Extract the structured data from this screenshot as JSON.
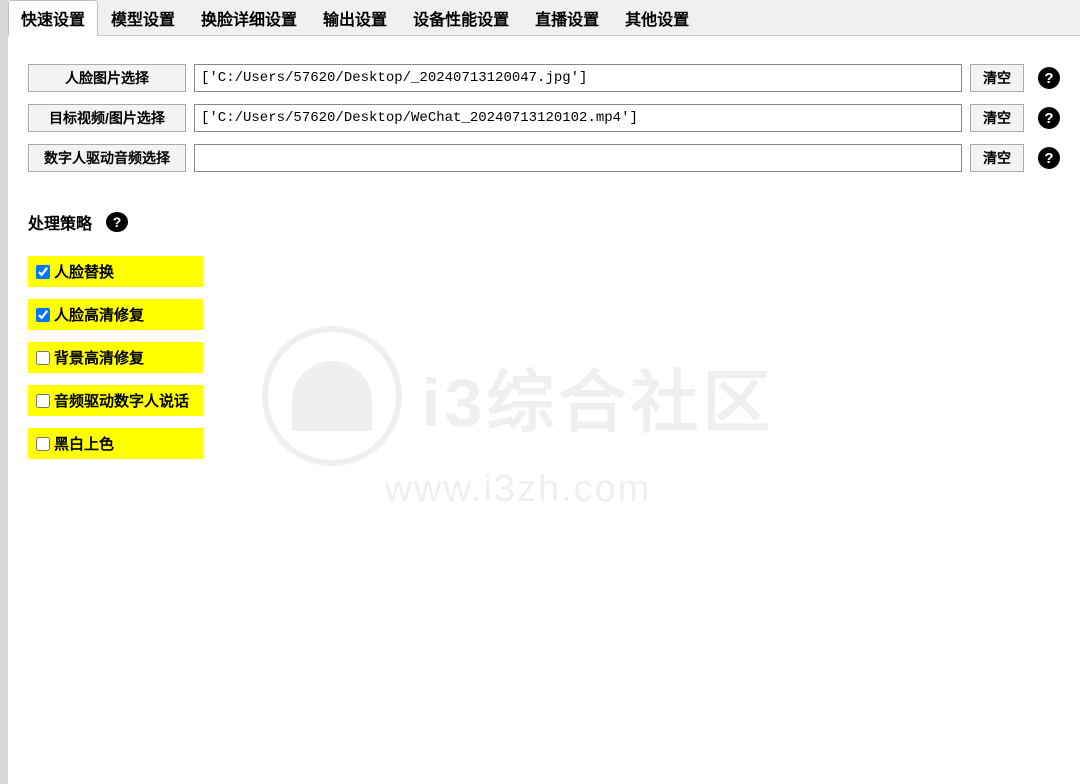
{
  "tabs": [
    {
      "label": "快速设置",
      "active": true
    },
    {
      "label": "模型设置",
      "active": false
    },
    {
      "label": "换脸详细设置",
      "active": false
    },
    {
      "label": "输出设置",
      "active": false
    },
    {
      "label": "设备性能设置",
      "active": false
    },
    {
      "label": "直播设置",
      "active": false
    },
    {
      "label": "其他设置",
      "active": false
    }
  ],
  "inputs": {
    "face_image": {
      "button": "人脸图片选择",
      "value": "['C:/Users/57620/Desktop/_20240713120047.jpg']",
      "clear": "清空"
    },
    "target_media": {
      "button": "目标视频/图片选择",
      "value": "['C:/Users/57620/Desktop/WeChat_20240713120102.mp4']",
      "clear": "清空"
    },
    "audio": {
      "button": "数字人驱动音频选择",
      "value": "",
      "clear": "清空"
    }
  },
  "strategy": {
    "title": "处理策略",
    "options": [
      {
        "label": "人脸替换",
        "checked": true
      },
      {
        "label": "人脸高清修复",
        "checked": true
      },
      {
        "label": "背景高清修复",
        "checked": false
      },
      {
        "label": "音频驱动数字人说话",
        "checked": false
      },
      {
        "label": "黑白上色",
        "checked": false
      }
    ]
  },
  "watermark": {
    "text": "i3综合社区",
    "url": "www.i3zh.com"
  }
}
